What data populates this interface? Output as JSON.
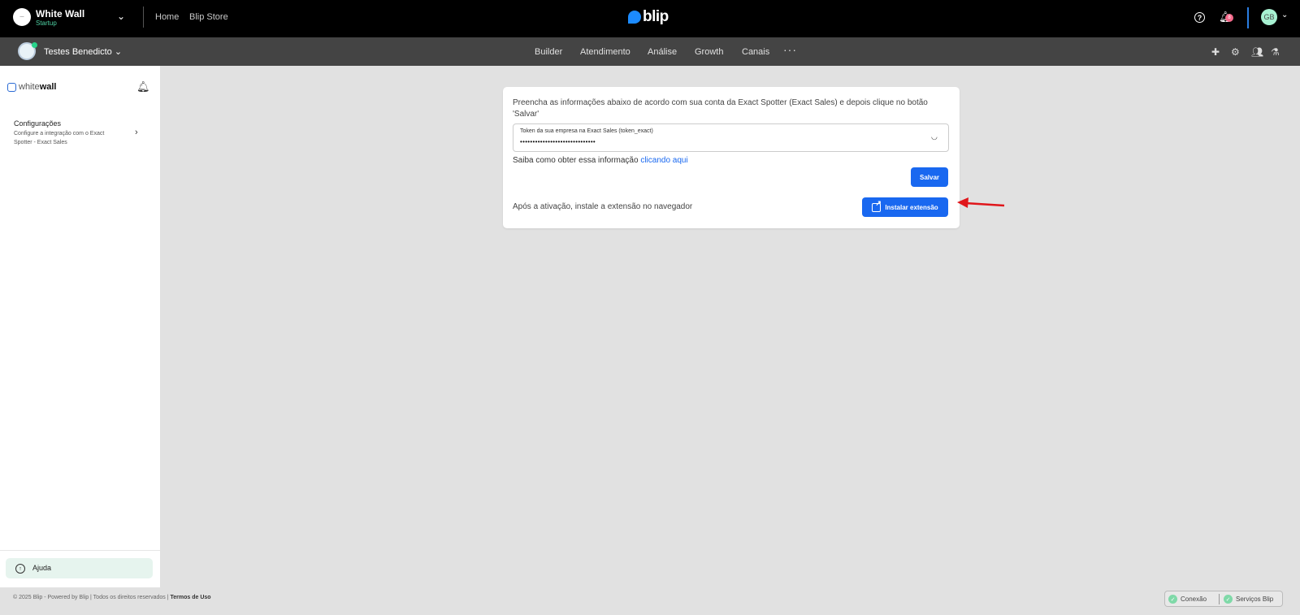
{
  "topbar": {
    "workspace_name": "White Wall",
    "workspace_plan": "Startup",
    "logo_text": "—",
    "nav": [
      "Home",
      "Blip Store"
    ],
    "brand": "blip",
    "notification_count": "8",
    "user_initials": "GB"
  },
  "subbar": {
    "bot_name": "Testes Benedicto",
    "nav": [
      "Builder",
      "Atendimento",
      "Análise",
      "Growth",
      "Canais"
    ],
    "more": "···"
  },
  "sidebar": {
    "logo_light": "white",
    "logo_bold": "wall",
    "config_title": "Configurações",
    "config_desc": "Configure a integração com o Exact Spotter - Exact Sales",
    "help_label": "Ajuda"
  },
  "card": {
    "intro": "Preencha as informações abaixo de acordo com sua conta da Exact Spotter (Exact Sales) e depois clique no botão 'Salvar'",
    "token_label": "Token da sua empresa na Exact Sales (token_exact)",
    "token_value": "••••••••••••••••••••••••••••••",
    "howto_prefix": "Saiba como obter essa informação",
    "howto_link": "clicando aqui",
    "save_label": "Salvar",
    "after_text": "Após a ativação, instale a extensão no navegador",
    "install_label": "Instalar extensão"
  },
  "footer": {
    "copyright": "© 2025 Blip - Powered by Blip | Todos os direitos reservados |",
    "terms": "Termos de Uso",
    "status_connection": "Conexão",
    "status_services": "Serviços Blip"
  },
  "colors": {
    "accent": "#1968f0",
    "annotation_arrow": "#e0161b",
    "status_ok": "#7fd9a8"
  },
  "icons": [
    "help-icon",
    "bell-icon",
    "chevron-down-icon",
    "eye-closed-icon",
    "external-link-icon",
    "puzzle-icon",
    "gear-icon",
    "users-icon",
    "flask-icon",
    "check-icon"
  ]
}
